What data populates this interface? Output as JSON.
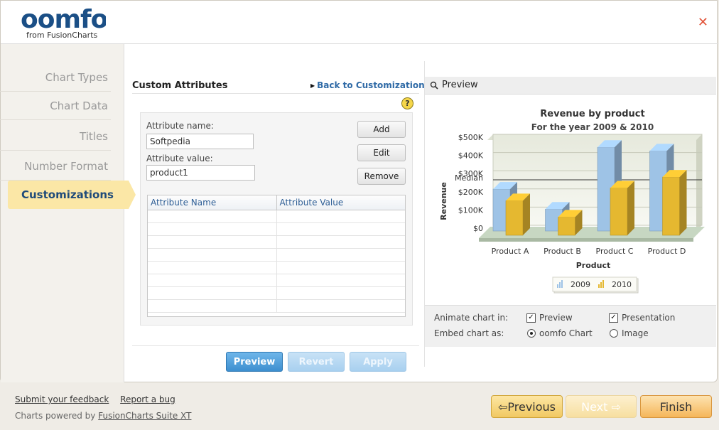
{
  "app": {
    "logo_text": "oomfo",
    "logo_subtitle": "from FusionCharts",
    "close_label": "✕"
  },
  "sidebar": {
    "items": [
      {
        "label": "Chart Types"
      },
      {
        "label": "Chart Data"
      },
      {
        "label": "Titles"
      },
      {
        "label": "Number Format"
      },
      {
        "label": "Customizations"
      }
    ]
  },
  "custom": {
    "title": "Custom Attributes",
    "back_link": "Back to Customization",
    "help": "?",
    "attr_name_label": "Attribute name:",
    "attr_name_value": "Softpedia",
    "attr_value_label": "Attribute value:",
    "attr_value_value": "product1",
    "add_label": "Add",
    "edit_label": "Edit",
    "remove_label": "Remove",
    "grid_headers": [
      "Attribute Name",
      "Attribute Value"
    ]
  },
  "actions": {
    "preview": "Preview",
    "revert": "Revert",
    "apply": "Apply"
  },
  "preview": {
    "header": "Preview",
    "animate_label": "Animate chart in:",
    "animate_preview": "Preview",
    "animate_presentation": "Presentation",
    "embed_label": "Embed chart as:",
    "embed_oomfo": "oomfo Chart",
    "embed_image": "Image"
  },
  "chart_data": {
    "type": "bar",
    "title": "Revenue by product",
    "subtitle": "For the year 2009 & 2010",
    "xlabel": "Product",
    "ylabel": "Revenue",
    "categories": [
      "Product A",
      "Product B",
      "Product C",
      "Product D"
    ],
    "series": [
      {
        "name": "2009",
        "values": [
          230,
          120,
          460,
          440
        ],
        "color": "#9ec3e6"
      },
      {
        "name": "2010",
        "values": [
          190,
          100,
          260,
          320
        ],
        "color": "#e5b830"
      }
    ],
    "ylim": [
      0,
      500
    ],
    "yticks": [
      "$0",
      "$100K",
      "$200K",
      "$300K",
      "$400K",
      "$500K"
    ],
    "trendline": {
      "label": "Median",
      "value": 250
    },
    "legend": "bottom"
  },
  "footer": {
    "feedback": "Submit your feedback",
    "bug": "Report a bug",
    "powered_prefix": "Charts powered by",
    "powered_link": "FusionCharts Suite XT",
    "previous": "⇦Previous",
    "next": "Next ⇨",
    "finish": "Finish"
  }
}
